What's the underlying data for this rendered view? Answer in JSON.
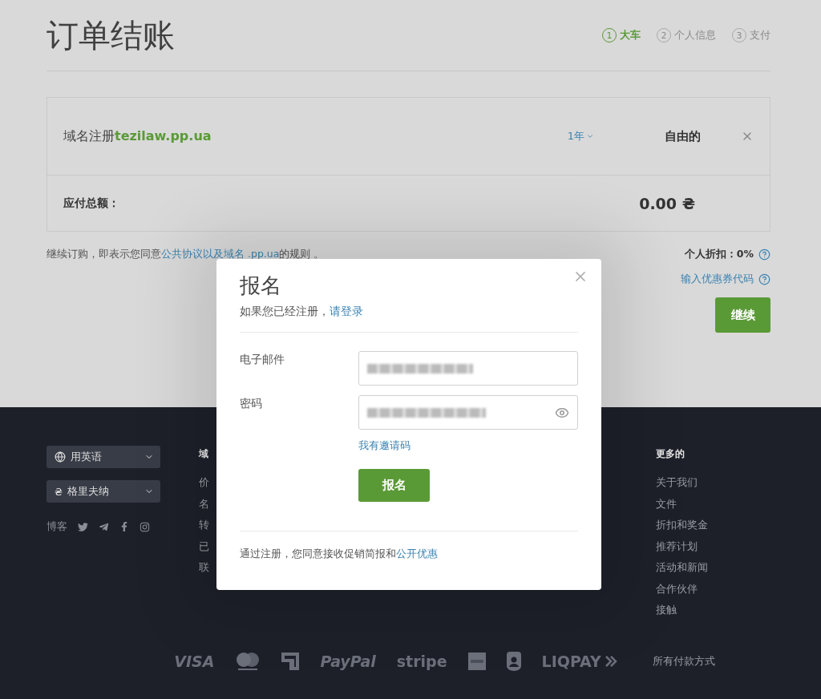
{
  "page_title": "订单结账",
  "steps": [
    {
      "number": "1",
      "label": "大车",
      "selected": true
    },
    {
      "number": "2",
      "label": "个人信息",
      "selected": false
    },
    {
      "number": "3",
      "label": "支付",
      "selected": false
    }
  ],
  "cart": {
    "items": [
      {
        "label": "域名注册",
        "domain": "tezilaw.pp.ua",
        "period": "1年",
        "price": "自由的"
      }
    ],
    "total_label": "应付总额：",
    "total": "0.00 ₴"
  },
  "terms": {
    "text": "继续订购，即表示您同意",
    "link": "公共协议以及域名 .pp.ua",
    "suffix": "的规则 。"
  },
  "discount": {
    "label": "个人折扣：",
    "value": "0%"
  },
  "promo_link": "输入优惠券代码",
  "continue_button": "继续",
  "footer": {
    "selects": [
      {
        "kind": "language",
        "label": "用英语"
      },
      {
        "kind": "currency",
        "symbol": "₴",
        "label": "格里夫纳"
      }
    ],
    "blog_label": "博客",
    "columns": [
      {
        "heading": "域",
        "items": [
          "价",
          "名",
          "转",
          "已",
          "联"
        ]
      },
      {
        "heading": "更多的",
        "items": [
          "关于我们",
          "文件",
          "折扣和奖金",
          "推荐计划",
          "活动和新闻",
          "合作伙伴",
          "接触"
        ]
      }
    ],
    "payments": [
      {
        "kind": "italic-text",
        "label": "VISA"
      },
      {
        "kind": "mastercard"
      },
      {
        "kind": "privat"
      },
      {
        "kind": "italic-text",
        "label": "PayPal"
      },
      {
        "kind": "text",
        "label": "stripe"
      },
      {
        "kind": "amex"
      },
      {
        "kind": "person"
      },
      {
        "kind": "liqpay",
        "label": "LIQPAY"
      }
    ],
    "all_payments": "所有付款方式"
  },
  "modal": {
    "title": "报名",
    "subtitle": "如果您已经注册，",
    "login_link": "请登录",
    "fields": [
      {
        "kind": "email",
        "label": "电子邮件"
      },
      {
        "kind": "password",
        "label": "密码"
      }
    ],
    "invite_link": "我有邀请码",
    "submit": "报名",
    "consent": "通过注册，您同意接收促销简报和",
    "consent_link": "公开优惠"
  }
}
